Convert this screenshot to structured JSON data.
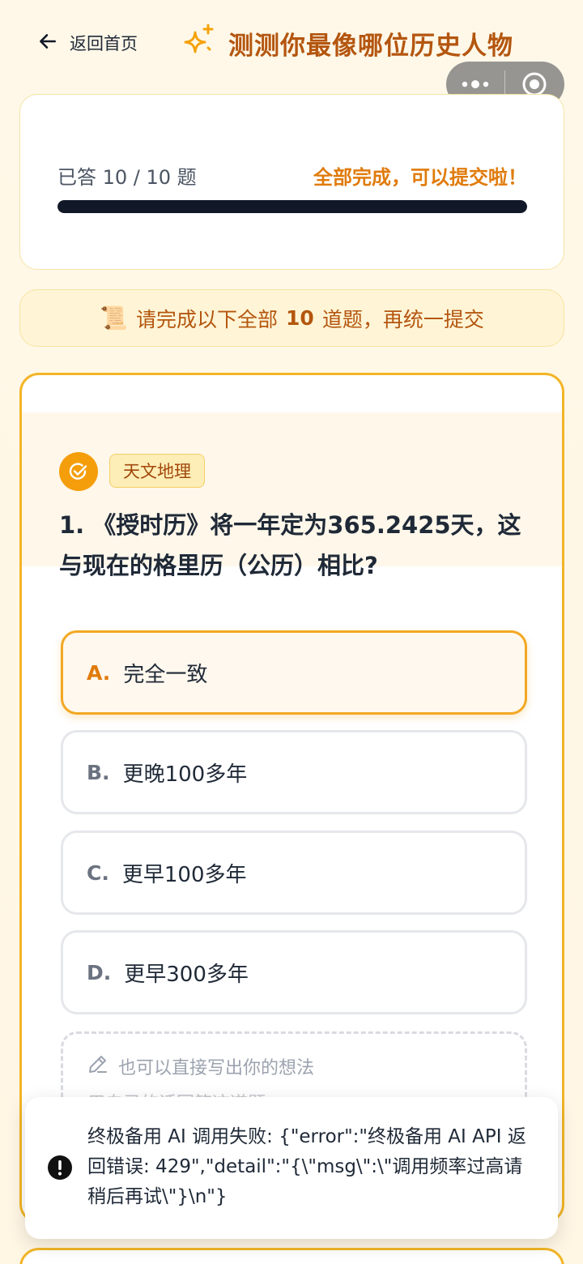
{
  "header": {
    "back_label": "返回首页",
    "title": "测测你最像哪位历史人物",
    "accent_color": "#b4560f"
  },
  "progress": {
    "answered_text": "已答 10 / 10 题",
    "complete_text": "全部完成，可以提交啦！",
    "answered": 10,
    "total": 10,
    "fraction": 1.0
  },
  "notice": {
    "prefix": "请完成以下全部",
    "count": "10",
    "suffix": "道题，再统一提交"
  },
  "question": {
    "category": "天文地理",
    "text": "1. 《授时历》将一年定为365.2425天，这与现在的格里历（公历）相比?",
    "options": [
      {
        "letter": "A.",
        "text": "完全一致",
        "selected": true
      },
      {
        "letter": "B.",
        "text": "更晚100多年",
        "selected": false
      },
      {
        "letter": "C.",
        "text": "更早100多年",
        "selected": false
      },
      {
        "letter": "D.",
        "text": "更早300多年",
        "selected": false
      }
    ],
    "freeform_label": "也可以直接写出你的想法",
    "freeform_placeholder": "用自己的话回答这道题"
  },
  "toast": {
    "message": "终极备用 AI 调用失败: {\"error\":\"终极备用 AI API 返回错误: 429\",\"detail\":\"{\\\"msg\\\":\\\"调用频率过高请稍后再试\\\"}\\n\"}"
  },
  "icons": {
    "back": "arrow-left-icon",
    "title": "sparkles-icon",
    "capsule_more": "more-dots-icon",
    "capsule_close": "target-circle-icon",
    "badge": "check-circle-icon",
    "notice": "scroll-emoji",
    "freeform": "pencil-icon",
    "toast": "exclamation-circle-icon"
  }
}
